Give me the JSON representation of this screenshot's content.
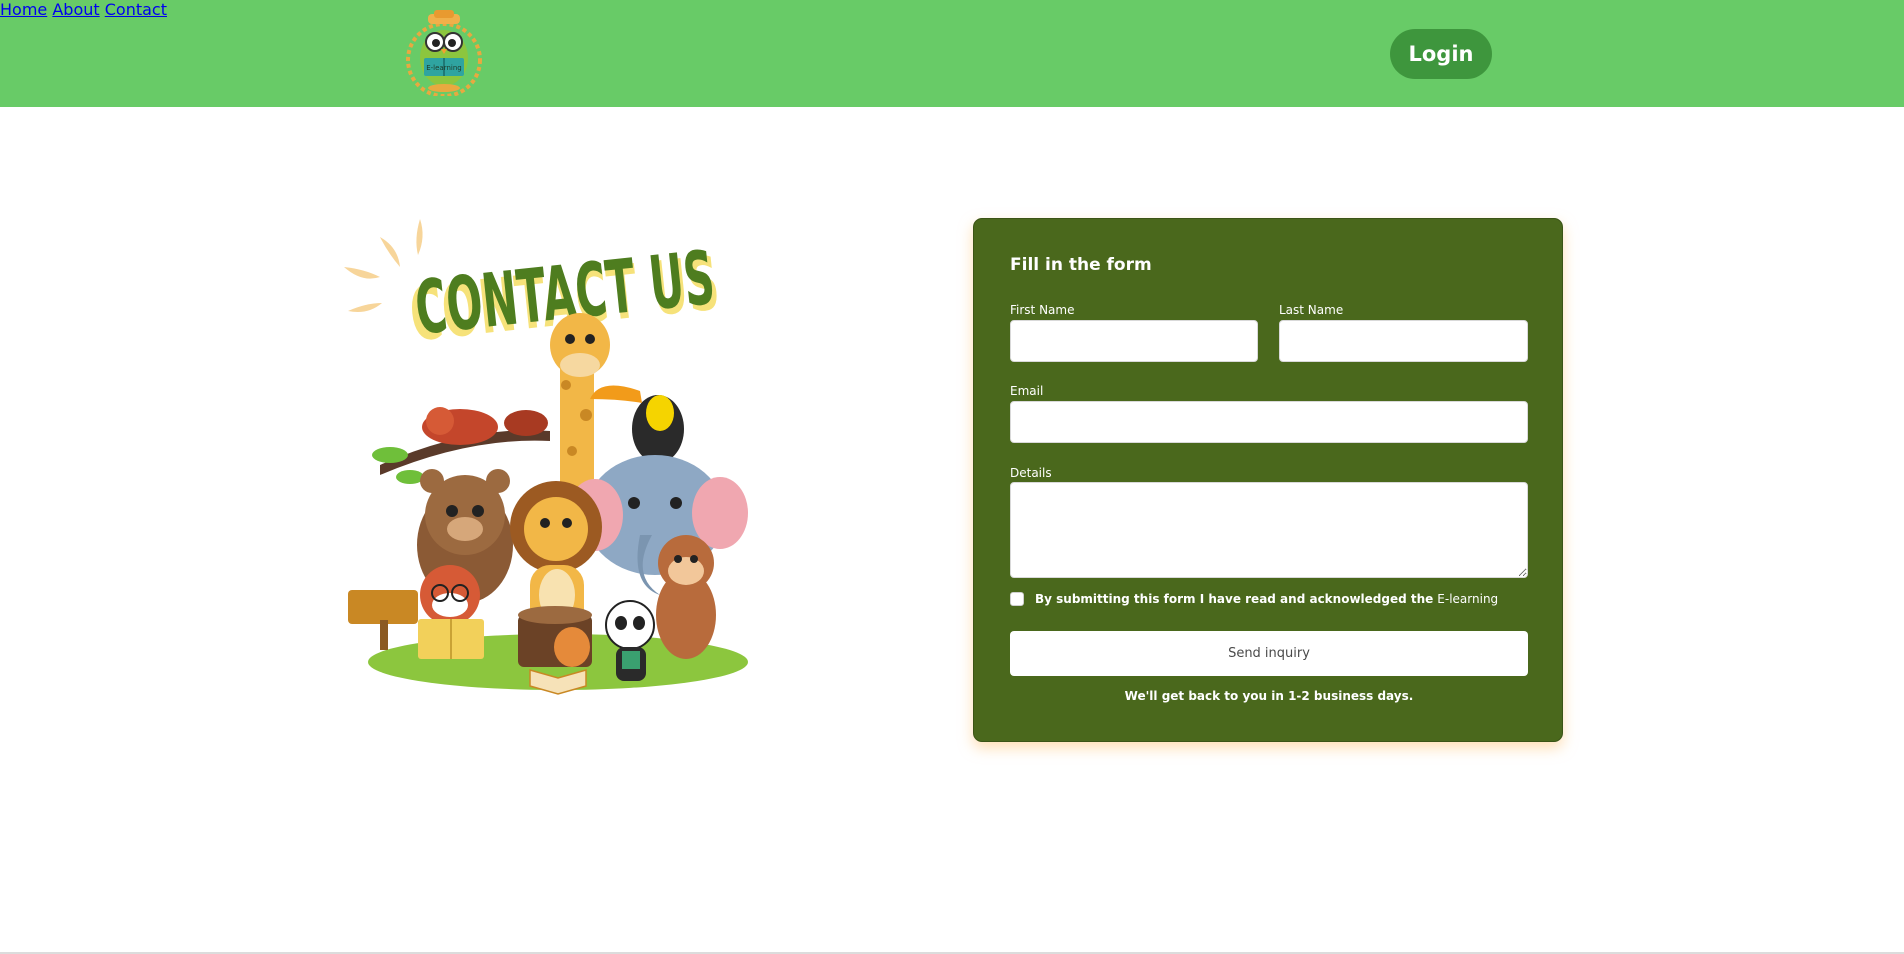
{
  "header": {
    "logo_icon": "owl-reading-book-logo",
    "nav": [
      {
        "label": "Home"
      },
      {
        "label": "About"
      },
      {
        "label": "Contact"
      }
    ],
    "login_label": "Login",
    "colors": {
      "bar": "#68cb67",
      "login": "#3e963d"
    }
  },
  "hero": {
    "heading": "CONTACT US",
    "illustration": "zoo-animals-group"
  },
  "form": {
    "title": "Fill in the form",
    "first_name": {
      "label": "First Name",
      "value": ""
    },
    "last_name": {
      "label": "Last Name",
      "value": ""
    },
    "email": {
      "label": "Email",
      "value": ""
    },
    "details": {
      "label": "Details",
      "value": ""
    },
    "consent": {
      "text": "By submitting this form I have read and acknowledged the",
      "link": "E-learning",
      "checked": false
    },
    "submit_label": "Send inquiry",
    "reply_note": "We'll get back to you in 1-2 business days.",
    "colors": {
      "card": "#4a681c",
      "glow": "#ffc478"
    }
  }
}
